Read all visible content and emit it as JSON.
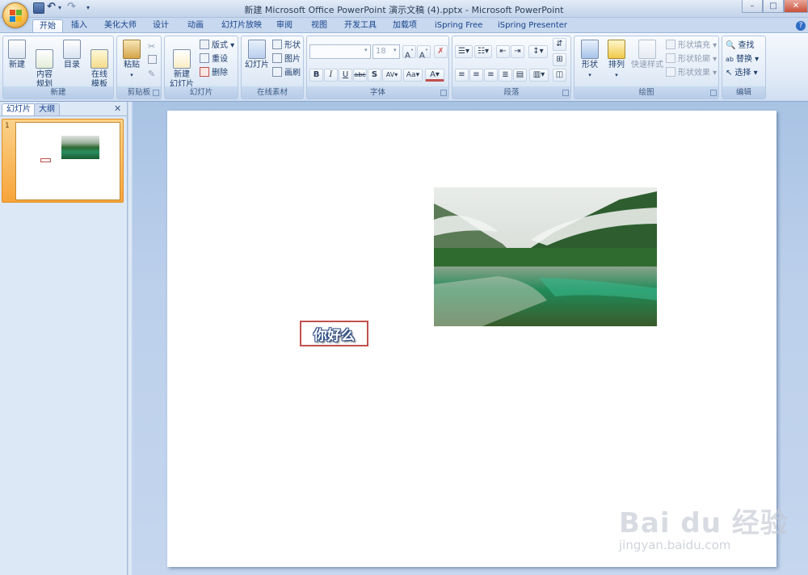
{
  "window": {
    "title": "新建 Microsoft Office PowerPoint 演示文稿 (4).pptx - Microsoft PowerPoint",
    "controls": {
      "minimize": "–",
      "maximize": "□",
      "close": "✕"
    }
  },
  "ribbon_tabs": [
    "开始",
    "插入",
    "美化大师",
    "设计",
    "动画",
    "幻灯片放映",
    "审阅",
    "视图",
    "开发工具",
    "加载项",
    "iSpring Free",
    "iSpring Presenter"
  ],
  "active_tab": "开始",
  "groups": {
    "new": {
      "label": "新建",
      "buttons": [
        "新建",
        "内容\n规划",
        "目录",
        "在线\n模板"
      ]
    },
    "clipboard": {
      "label": "剪贴板",
      "paste": "粘贴"
    },
    "slides": {
      "label": "幻灯片",
      "new_slide": "新建\n幻灯片",
      "layout": "版式",
      "reset": "重设",
      "delete": "删除"
    },
    "online": {
      "label": "在线素材",
      "slide": "幻灯片",
      "shape": "形状",
      "picture": "图片",
      "brush": "画刷"
    },
    "font": {
      "label": "字体",
      "font_name": "",
      "font_size": "18"
    },
    "paragraph": {
      "label": "段落"
    },
    "drawing": {
      "label": "绘图",
      "shapes": "形状",
      "arrange": "排列",
      "quick_styles": "快速样式",
      "fill": "形状填充",
      "outline": "形状轮廓",
      "effects": "形状效果"
    },
    "editing": {
      "label": "编辑",
      "find": "查找",
      "replace": "替换",
      "select": "选择"
    }
  },
  "pane_tabs": {
    "slides": "幻灯片",
    "outline": "大纲",
    "close": "✕"
  },
  "thumbnail": {
    "number": "1"
  },
  "slide": {
    "text": "你好么"
  },
  "watermark": {
    "logo": "Bai du 经验",
    "url": "jingyan.baidu.com"
  },
  "colors": {
    "accent": "#c0504d",
    "ribbon": "#dfe9f6",
    "thumb_selected": "#f7a43a"
  }
}
